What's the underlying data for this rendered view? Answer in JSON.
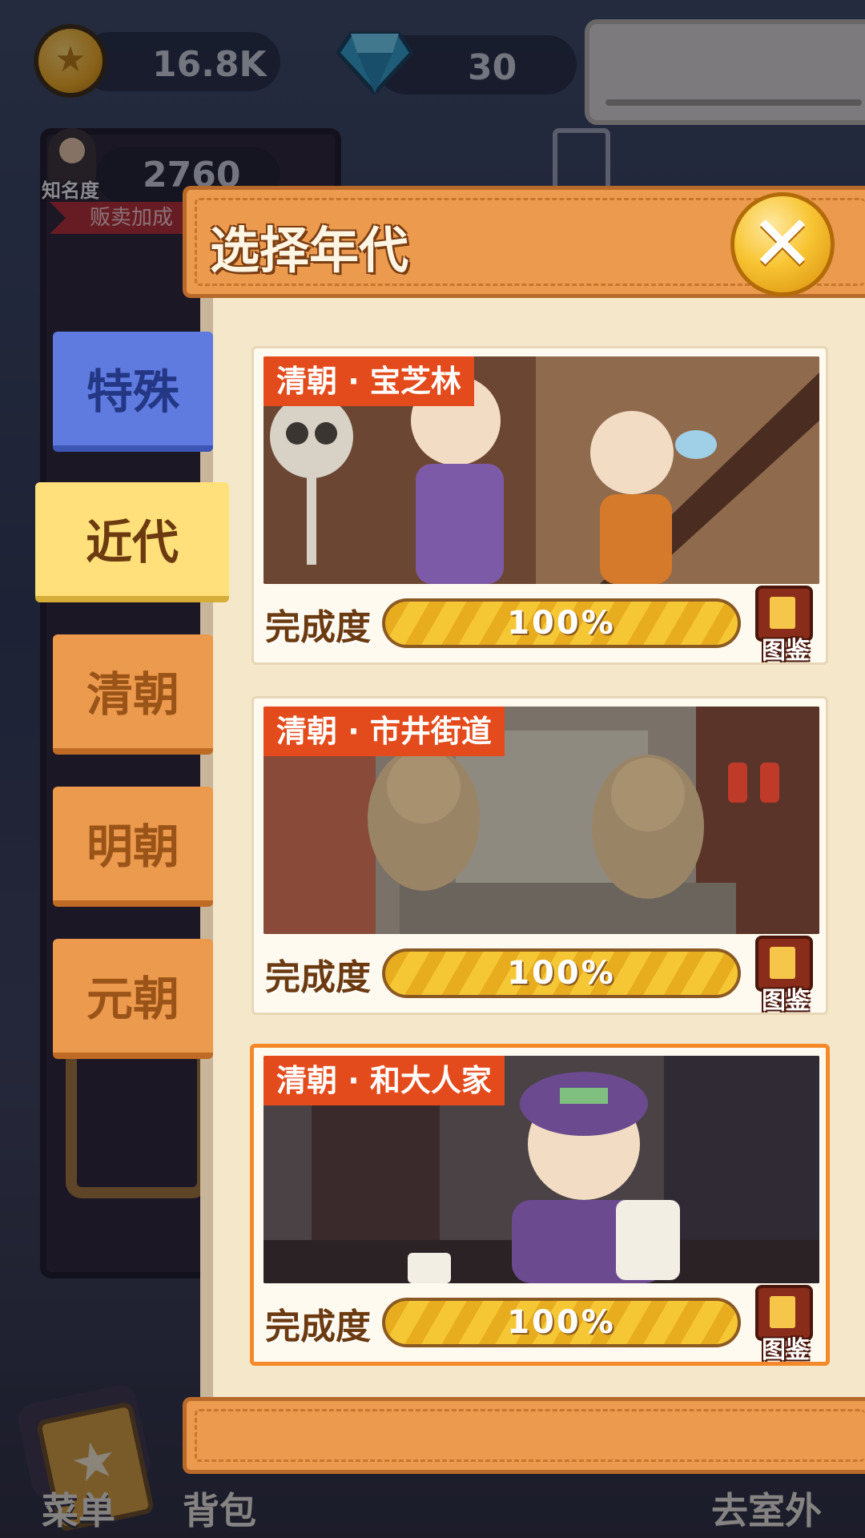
{
  "hud": {
    "coins": "16.8K",
    "gems": "30",
    "fame_label": "知名度",
    "fame_value": "2760",
    "bonus_ribbon": "贩卖加成"
  },
  "bottom_nav": {
    "menu": "菜单",
    "bag": "背包",
    "outdoor": "去室外"
  },
  "modal": {
    "title": "选择年代",
    "close_icon": "close-icon"
  },
  "era_tabs": [
    {
      "label": "特殊",
      "state": "normal",
      "color": "#5f7be0"
    },
    {
      "label": "近代",
      "state": "selected",
      "color": "#ffe07a"
    },
    {
      "label": "清朝",
      "state": "normal",
      "color": "#ec9a4e"
    },
    {
      "label": "明朝",
      "state": "normal",
      "color": "#ec9a4e"
    },
    {
      "label": "元朝",
      "state": "normal",
      "color": "#ec9a4e"
    }
  ],
  "stages": [
    {
      "tag": "清朝 · 宝芝林",
      "progress_label": "完成度",
      "progress_text": "100%",
      "progress": 1.0,
      "atlas_label": "图鉴",
      "selected": false
    },
    {
      "tag": "清朝 · 市井街道",
      "progress_label": "完成度",
      "progress_text": "100%",
      "progress": 1.0,
      "atlas_label": "图鉴",
      "selected": false
    },
    {
      "tag": "清朝 · 和大人家",
      "progress_label": "完成度",
      "progress_text": "100%",
      "progress": 1.0,
      "atlas_label": "图鉴",
      "selected": true
    }
  ],
  "colors": {
    "accent_orange": "#ec9a4e",
    "tag_red": "#e44b1c",
    "progress_yellow": "#f6c734",
    "panel_cream": "#f5e7c9"
  }
}
